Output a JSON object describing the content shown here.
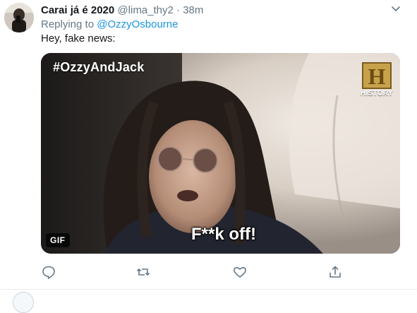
{
  "tweet": {
    "display_name": "Carai já é 2020",
    "handle": "@lima_thy2",
    "separator": "·",
    "time": "38m",
    "replying_prefix": "Replying to",
    "replying_to": "@OzzyOsbourne",
    "text": "Hey, fake news:",
    "media": {
      "type": "gif",
      "hashtag": "#OzzyAndJack",
      "channel_logo_letter": "H",
      "channel_name": "HISTORY",
      "caption": "F**k off!",
      "badge": "GIF"
    },
    "actions": [
      {
        "name": "reply",
        "icon": "comment-icon"
      },
      {
        "name": "retweet",
        "icon": "retweet-icon"
      },
      {
        "name": "like",
        "icon": "heart-icon"
      },
      {
        "name": "share",
        "icon": "share-icon"
      }
    ]
  },
  "colors": {
    "text_primary": "#14171a",
    "text_secondary": "#657786",
    "link": "#1b95e0",
    "divider": "#e6ecf0",
    "history_logo": "#c8a24a"
  }
}
